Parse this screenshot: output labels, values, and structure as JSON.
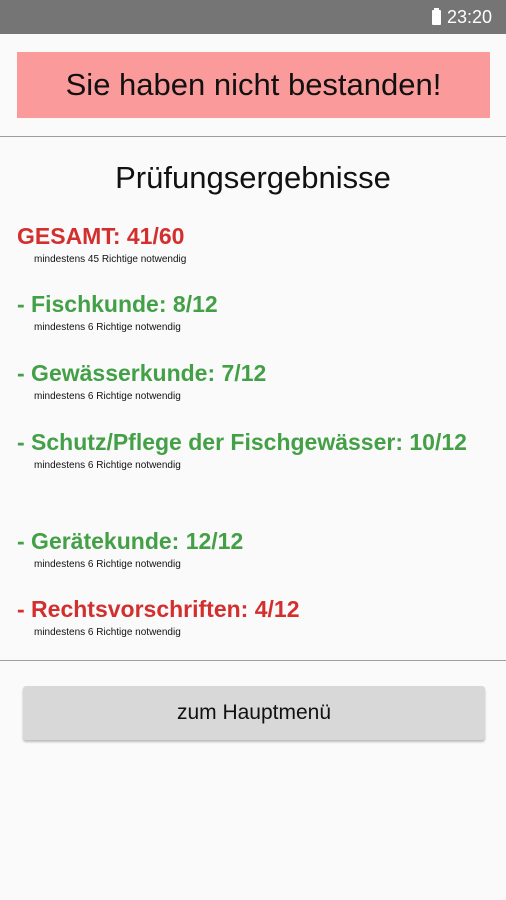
{
  "status_bar": {
    "time": "23:20",
    "battery_icon": "battery-icon"
  },
  "banner": {
    "text": "Sie haben nicht bestanden!",
    "color": "#fa9a9a"
  },
  "results": {
    "title": "Prüfungsergebnisse",
    "items": [
      {
        "label": "GESAMT: 41/60",
        "note": "mindestens 45 Richtige notwendig",
        "status": "fail"
      },
      {
        "label": "- Fischkunde: 8/12",
        "note": "mindestens 6 Richtige notwendig",
        "status": "pass"
      },
      {
        "label": "- Gewässerkunde: 7/12",
        "note": "mindestens 6 Richtige notwendig",
        "status": "pass"
      },
      {
        "label": "- Schutz/Pflege der Fischgewässer: 10/12",
        "note": "mindestens 6 Richtige notwendig",
        "status": "pass"
      },
      {
        "label": "- Gerätekunde: 12/12",
        "note": "mindestens 6 Richtige notwendig",
        "status": "pass"
      },
      {
        "label": "- Rechtsvorschriften: 4/12",
        "note": "mindestens 6 Richtige notwendig",
        "status": "fail"
      }
    ],
    "colors": {
      "fail": "#d32f2f",
      "pass": "#43a047"
    }
  },
  "main_menu_button": {
    "label": "zum Hauptmenü"
  }
}
